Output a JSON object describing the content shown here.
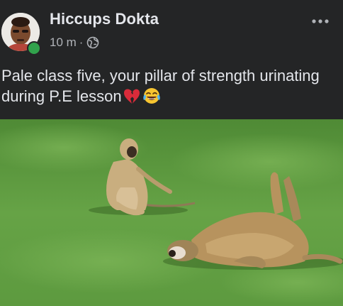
{
  "post": {
    "author": {
      "name": "Hiccups Dokta",
      "online": true
    },
    "timestamp": "10 m",
    "separator": "·",
    "privacy_icon": "globe-icon",
    "more_icon": "more-options-icon",
    "text": "Pale class five, your pillar of strength urinating during P.E lesson",
    "emojis": [
      "broken-heart-emoji",
      "tears-of-joy-emoji"
    ],
    "image": {
      "subject": "monkey sitting on grass and baboon lying on its back on grass"
    }
  },
  "colors": {
    "background": "#242526",
    "primary_text": "#e4e6eb",
    "secondary_text": "#b0b3b8",
    "online": "#31a24c",
    "grass": "#5f9a3f"
  }
}
